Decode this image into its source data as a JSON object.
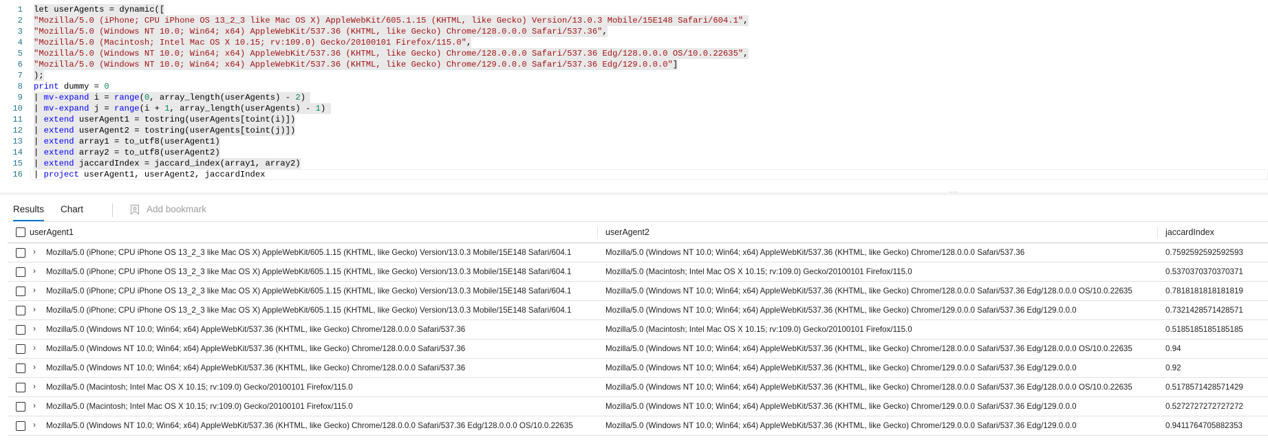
{
  "editor": {
    "lines": [
      {
        "n": "1",
        "tokens": [
          {
            "t": "let userAgents = dynamic([",
            "c": "plain"
          }
        ]
      },
      {
        "n": "2",
        "tokens": [
          {
            "t": "\"Mozilla/5.0 (iPhone; CPU iPhone OS 13_2_3 like Mac OS X) AppleWebKit/605.1.15 (KHTML, like Gecko) Version/13.0.3 Mobile/15E148 Safari/604.1\"",
            "c": "str"
          },
          {
            "t": ",",
            "c": "plain"
          }
        ]
      },
      {
        "n": "3",
        "tokens": [
          {
            "t": "\"Mozilla/5.0 (Windows NT 10.0; Win64; x64) AppleWebKit/537.36 (KHTML, like Gecko) Chrome/128.0.0.0 Safari/537.36\"",
            "c": "str"
          },
          {
            "t": ",",
            "c": "plain"
          }
        ]
      },
      {
        "n": "4",
        "tokens": [
          {
            "t": "\"Mozilla/5.0 (Macintosh; Intel Mac OS X 10.15; rv:109.0) Gecko/20100101 Firefox/115.0\"",
            "c": "str"
          },
          {
            "t": ",",
            "c": "plain"
          }
        ]
      },
      {
        "n": "5",
        "tokens": [
          {
            "t": "\"Mozilla/5.0 (Windows NT 10.0; Win64; x64) AppleWebKit/537.36 (KHTML, like Gecko) Chrome/128.0.0.0 Safari/537.36 Edg/128.0.0.0 OS/10.0.22635\"",
            "c": "str"
          },
          {
            "t": ",",
            "c": "plain"
          }
        ]
      },
      {
        "n": "6",
        "tokens": [
          {
            "t": "\"Mozilla/5.0 (Windows NT 10.0; Win64; x64) AppleWebKit/537.36 (KHTML, like Gecko) Chrome/129.0.0.0 Safari/537.36 Edg/129.0.0.0\"",
            "c": "str"
          },
          {
            "t": "]",
            "c": "plain"
          }
        ]
      },
      {
        "n": "7",
        "tokens": [
          {
            "t": ");",
            "c": "plain"
          }
        ]
      },
      {
        "n": "8",
        "tokens": [
          {
            "t": "print",
            "c": "kw"
          },
          {
            "t": " dummy = ",
            "c": "plain"
          },
          {
            "t": "0",
            "c": "num"
          }
        ]
      },
      {
        "n": "9",
        "tokens": [
          {
            "t": "| ",
            "c": "plain"
          },
          {
            "t": "mv-expand",
            "c": "kw"
          },
          {
            "t": " i = ",
            "c": "plain"
          },
          {
            "t": "range",
            "c": "kw"
          },
          {
            "t": "(",
            "c": "plain"
          },
          {
            "t": "0",
            "c": "num"
          },
          {
            "t": ", array_length(userAgents) - ",
            "c": "plain"
          },
          {
            "t": "2",
            "c": "num"
          },
          {
            "t": ")",
            "c": "plain"
          }
        ]
      },
      {
        "n": "10",
        "tokens": [
          {
            "t": "| ",
            "c": "plain"
          },
          {
            "t": "mv-expand",
            "c": "kw"
          },
          {
            "t": " j = ",
            "c": "plain"
          },
          {
            "t": "range",
            "c": "kw"
          },
          {
            "t": "(i + ",
            "c": "plain"
          },
          {
            "t": "1",
            "c": "num"
          },
          {
            "t": ", array_length(userAgents) - ",
            "c": "plain"
          },
          {
            "t": "1",
            "c": "num"
          },
          {
            "t": ")",
            "c": "plain"
          }
        ]
      },
      {
        "n": "11",
        "tokens": [
          {
            "t": "| ",
            "c": "plain"
          },
          {
            "t": "extend",
            "c": "kw"
          },
          {
            "t": " userAgent1 = tostring(userAgents[toint(i)])",
            "c": "plain"
          }
        ]
      },
      {
        "n": "12",
        "tokens": [
          {
            "t": "| ",
            "c": "plain"
          },
          {
            "t": "extend",
            "c": "kw"
          },
          {
            "t": " userAgent2 = tostring(userAgents[toint(j)])",
            "c": "plain"
          }
        ]
      },
      {
        "n": "13",
        "tokens": [
          {
            "t": "| ",
            "c": "plain"
          },
          {
            "t": "extend",
            "c": "kw"
          },
          {
            "t": " array1 = to_utf8(userAgent1)",
            "c": "plain"
          }
        ]
      },
      {
        "n": "14",
        "tokens": [
          {
            "t": "| ",
            "c": "plain"
          },
          {
            "t": "extend",
            "c": "kw"
          },
          {
            "t": " array2 = to_utf8(userAgent2)",
            "c": "plain"
          }
        ]
      },
      {
        "n": "15",
        "tokens": [
          {
            "t": "| ",
            "c": "plain"
          },
          {
            "t": "extend",
            "c": "kw"
          },
          {
            "t": " jaccardIndex = jaccard_index(array1, array2)",
            "c": "plain"
          }
        ]
      },
      {
        "n": "16",
        "tokens": [
          {
            "t": "| ",
            "c": "plain"
          },
          {
            "t": "project",
            "c": "kw"
          },
          {
            "t": " userAgent1, userAgent2, jaccardIndex",
            "c": "plain"
          }
        ]
      }
    ]
  },
  "splitter": {
    "handle_icon": "more-horizontal-icon",
    "glyph": "···"
  },
  "tabs": {
    "results_label": "Results",
    "chart_label": "Chart",
    "bookmark_label": "Add bookmark",
    "bookmark_icon": "bookmark-icon"
  },
  "grid": {
    "columns": [
      "userAgent1",
      "userAgent2",
      "jaccardIndex"
    ],
    "expand_icon": "chevron-right-icon",
    "expand_glyph": "›",
    "rows": [
      {
        "userAgent1": "Mozilla/5.0 (iPhone; CPU iPhone OS 13_2_3 like Mac OS X) AppleWebKit/605.1.15 (KHTML, like Gecko) Version/13.0.3 Mobile/15E148 Safari/604.1",
        "userAgent2": "Mozilla/5.0 (Windows NT 10.0; Win64; x64) AppleWebKit/537.36 (KHTML, like Gecko) Chrome/128.0.0.0 Safari/537.36",
        "jaccardIndex": "0.7592592592592593"
      },
      {
        "userAgent1": "Mozilla/5.0 (iPhone; CPU iPhone OS 13_2_3 like Mac OS X) AppleWebKit/605.1.15 (KHTML, like Gecko) Version/13.0.3 Mobile/15E148 Safari/604.1",
        "userAgent2": "Mozilla/5.0 (Macintosh; Intel Mac OS X 10.15; rv:109.0) Gecko/20100101 Firefox/115.0",
        "jaccardIndex": "0.5370370370370371"
      },
      {
        "userAgent1": "Mozilla/5.0 (iPhone; CPU iPhone OS 13_2_3 like Mac OS X) AppleWebKit/605.1.15 (KHTML, like Gecko) Version/13.0.3 Mobile/15E148 Safari/604.1",
        "userAgent2": "Mozilla/5.0 (Windows NT 10.0; Win64; x64) AppleWebKit/537.36 (KHTML, like Gecko) Chrome/128.0.0.0 Safari/537.36 Edg/128.0.0.0 OS/10.0.22635",
        "jaccardIndex": "0.7818181818181819"
      },
      {
        "userAgent1": "Mozilla/5.0 (iPhone; CPU iPhone OS 13_2_3 like Mac OS X) AppleWebKit/605.1.15 (KHTML, like Gecko) Version/13.0.3 Mobile/15E148 Safari/604.1",
        "userAgent2": "Mozilla/5.0 (Windows NT 10.0; Win64; x64) AppleWebKit/537.36 (KHTML, like Gecko) Chrome/129.0.0.0 Safari/537.36 Edg/129.0.0.0",
        "jaccardIndex": "0.7321428571428571"
      },
      {
        "userAgent1": "Mozilla/5.0 (Windows NT 10.0; Win64; x64) AppleWebKit/537.36 (KHTML, like Gecko) Chrome/128.0.0.0 Safari/537.36",
        "userAgent2": "Mozilla/5.0 (Macintosh; Intel Mac OS X 10.15; rv:109.0) Gecko/20100101 Firefox/115.0",
        "jaccardIndex": "0.5185185185185185"
      },
      {
        "userAgent1": "Mozilla/5.0 (Windows NT 10.0; Win64; x64) AppleWebKit/537.36 (KHTML, like Gecko) Chrome/128.0.0.0 Safari/537.36",
        "userAgent2": "Mozilla/5.0 (Windows NT 10.0; Win64; x64) AppleWebKit/537.36 (KHTML, like Gecko) Chrome/128.0.0.0 Safari/537.36 Edg/128.0.0.0 OS/10.0.22635",
        "jaccardIndex": "0.94"
      },
      {
        "userAgent1": "Mozilla/5.0 (Windows NT 10.0; Win64; x64) AppleWebKit/537.36 (KHTML, like Gecko) Chrome/128.0.0.0 Safari/537.36",
        "userAgent2": "Mozilla/5.0 (Windows NT 10.0; Win64; x64) AppleWebKit/537.36 (KHTML, like Gecko) Chrome/129.0.0.0 Safari/537.36 Edg/129.0.0.0",
        "jaccardIndex": "0.92"
      },
      {
        "userAgent1": "Mozilla/5.0 (Macintosh; Intel Mac OS X 10.15; rv:109.0) Gecko/20100101 Firefox/115.0",
        "userAgent2": "Mozilla/5.0 (Windows NT 10.0; Win64; x64) AppleWebKit/537.36 (KHTML, like Gecko) Chrome/128.0.0.0 Safari/537.36 Edg/128.0.0.0 OS/10.0.22635",
        "jaccardIndex": "0.5178571428571429"
      },
      {
        "userAgent1": "Mozilla/5.0 (Macintosh; Intel Mac OS X 10.15; rv:109.0) Gecko/20100101 Firefox/115.0",
        "userAgent2": "Mozilla/5.0 (Windows NT 10.0; Win64; x64) AppleWebKit/537.36 (KHTML, like Gecko) Chrome/129.0.0.0 Safari/537.36 Edg/129.0.0.0",
        "jaccardIndex": "0.5272727272727272"
      },
      {
        "userAgent1": "Mozilla/5.0 (Windows NT 10.0; Win64; x64) AppleWebKit/537.36 (KHTML, like Gecko) Chrome/128.0.0.0 Safari/537.36 Edg/128.0.0.0 OS/10.0.22635",
        "userAgent2": "Mozilla/5.0 (Windows NT 10.0; Win64; x64) AppleWebKit/537.36 (KHTML, like Gecko) Chrome/129.0.0.0 Safari/537.36 Edg/129.0.0.0",
        "jaccardIndex": "0.9411764705882353"
      }
    ]
  },
  "colors": {
    "accent": "#0078d4",
    "keyword": "#0000ff",
    "string": "#a31515",
    "number": "#098658",
    "line_number": "#237893"
  }
}
